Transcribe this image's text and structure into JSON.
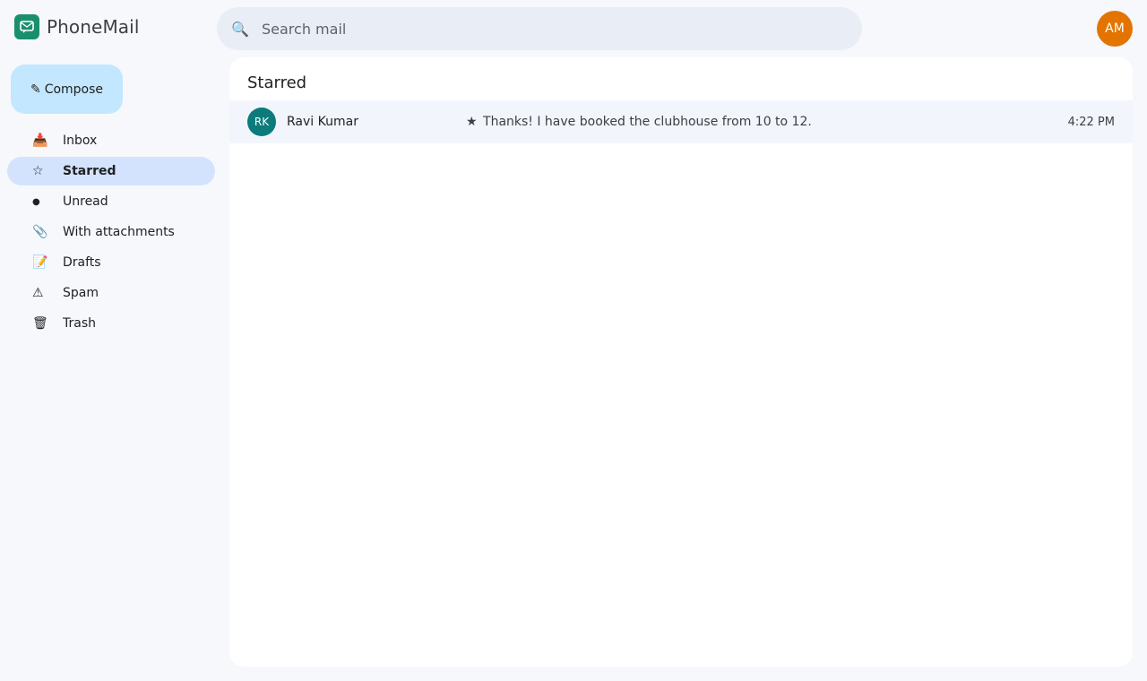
{
  "app": {
    "name": "PhoneMail",
    "logo_icon": "mail-chat-icon",
    "brand_color": "#1a8f6e"
  },
  "search": {
    "placeholder": "Search mail",
    "value": "",
    "icon": "search-icon"
  },
  "user": {
    "initials": "AM",
    "color": "#e37400"
  },
  "sidebar": {
    "compose_icon": "✎",
    "compose_label": "Compose",
    "items": [
      {
        "icon": "📥",
        "label": "Inbox",
        "icon_name": "inbox-icon"
      },
      {
        "icon": "☆",
        "label": "Starred",
        "icon_name": "star-icon",
        "active": true
      },
      {
        "icon": "●",
        "label": "Unread",
        "icon_name": "dot-icon"
      },
      {
        "icon": "📎",
        "label": "With attachments",
        "icon_name": "paperclip-icon"
      },
      {
        "icon": "📝",
        "label": "Drafts",
        "icon_name": "memo-icon"
      },
      {
        "icon": "⚠",
        "label": "Spam",
        "icon_name": "warning-icon"
      },
      {
        "icon": "🗑",
        "label": "Trash",
        "icon_name": "trash-icon"
      }
    ]
  },
  "main": {
    "title": "Starred",
    "messages": [
      {
        "initials": "RK",
        "avatar_color": "#0b7b7b",
        "sender": "Ravi Kumar",
        "star": "★",
        "snippet": "Thanks! I have booked the clubhouse from 10 to 12.",
        "time": "4:22 PM"
      }
    ]
  }
}
